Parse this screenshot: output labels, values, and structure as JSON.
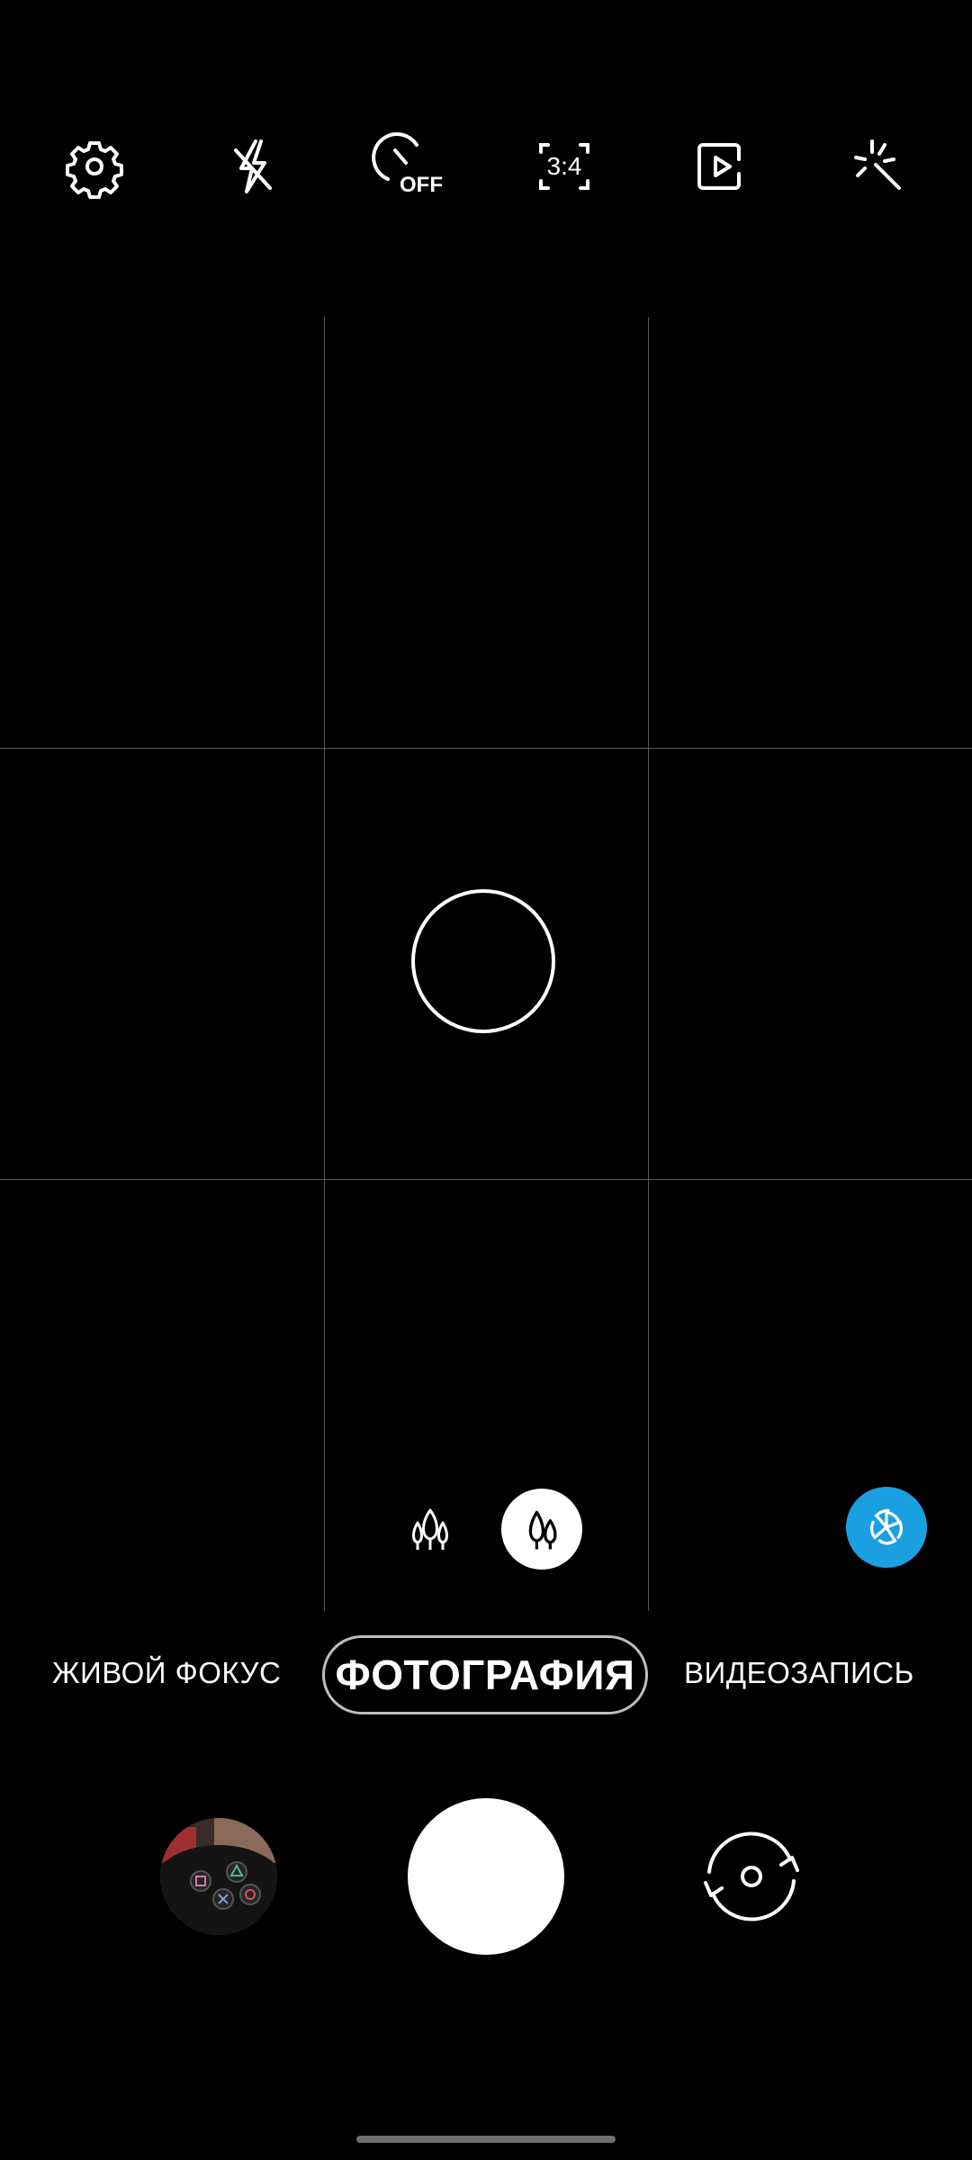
{
  "top_bar": {
    "icons": [
      "settings-icon",
      "flash-off-icon",
      "timer-off-icon",
      "aspect-ratio-icon",
      "motion-photo-icon",
      "filters-icon"
    ],
    "timer_label": "OFF",
    "ratio_label": "3:4"
  },
  "modes": {
    "live_focus": "ЖИВОЙ ФОКУС",
    "photo": "ФОТОГРАФИЯ",
    "video": "ВИДЕОЗАПИСЬ",
    "selected": "ФОТОГРАФИЯ"
  },
  "lenses": {
    "options": [
      "ultra-wide-lens-icon",
      "wide-lens-icon"
    ],
    "selected": "wide-lens-icon"
  },
  "colors": {
    "background": "#000000",
    "accent": "#1aa0e0",
    "foreground": "#ffffff"
  }
}
